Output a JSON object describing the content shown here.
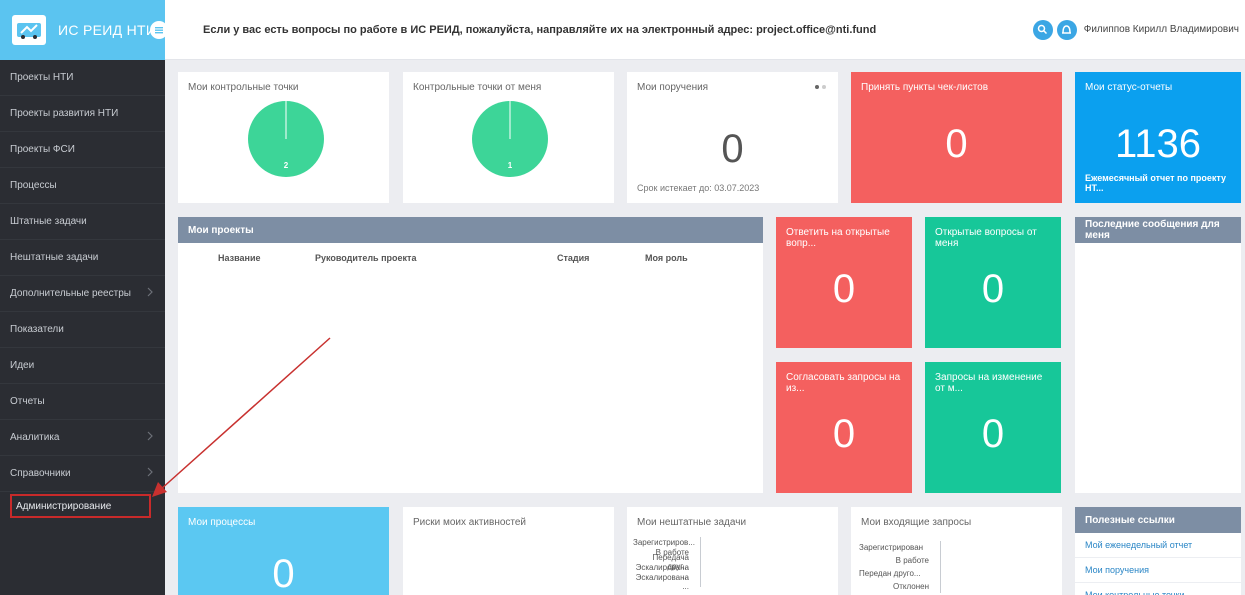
{
  "header": {
    "app_title": "ИС РЕИД НТИ",
    "notice": "Если у вас есть вопросы по работе в ИС РЕИД, пожалуйста, направляйте их на электронный адрес: project.office@nti.fund",
    "user_name": "Филиппов Кирилл Владимирович"
  },
  "sidebar": {
    "items": [
      {
        "label": "Проекты НТИ"
      },
      {
        "label": "Проекты развития НТИ"
      },
      {
        "label": "Проекты ФСИ"
      },
      {
        "label": "Процессы"
      },
      {
        "label": "Штатные задачи"
      },
      {
        "label": "Нештатные задачи"
      },
      {
        "label": "Дополнительные реестры"
      },
      {
        "label": "Показатели"
      },
      {
        "label": "Идеи"
      },
      {
        "label": "Отчеты"
      },
      {
        "label": "Аналитика"
      },
      {
        "label": "Справочники"
      },
      {
        "label": "Администрирование"
      }
    ]
  },
  "tiles": {
    "my_checkpoints": {
      "title": "Мои контрольные точки",
      "value": "2"
    },
    "checkpoints_from_me": {
      "title": "Контрольные точки от меня",
      "value": "1"
    },
    "my_orders": {
      "title": "Мои поручения",
      "value": "0",
      "footer": "Срок истекает до: 03.07.2023"
    },
    "accept_checklist": {
      "title": "Принять пункты чек-листов",
      "value": "0"
    },
    "my_status_reports": {
      "title": "Мои статус-отчеты",
      "value": "1136",
      "footer": "Ежемесячный отчет по проекту НТ..."
    },
    "answer_open_questions": {
      "title": "Ответить на открытые вопр...",
      "value": "0"
    },
    "open_questions_from_me": {
      "title": "Открытые вопросы от меня",
      "value": "0"
    },
    "approve_change_requests": {
      "title": "Согласовать запросы на из...",
      "value": "0"
    },
    "change_requests_from_me": {
      "title": "Запросы на изменение от м...",
      "value": "0"
    },
    "my_processes": {
      "title": "Мои процессы",
      "value": "0"
    },
    "activity_risks": {
      "title": "Риски моих активностей"
    },
    "my_unplanned_tasks": {
      "title": "Мои нештатные задачи",
      "rows": [
        "Зарегистриров...",
        "В работе",
        "Передача друг...",
        "Эскалирована ...",
        "Эскалирована ..."
      ]
    },
    "my_incoming_requests": {
      "title": "Мои входящие запросы",
      "rows": [
        "Зарегистрирован",
        "В работе",
        "Передан друго...",
        "Отклонен"
      ]
    }
  },
  "projects": {
    "title": "Мои проекты",
    "columns": [
      "Название",
      "Руководитель проекта",
      "Стадия",
      "Моя роль"
    ]
  },
  "messages": {
    "title": "Последние сообщения для меня"
  },
  "useful_links": {
    "title": "Полезные ссылки",
    "items": [
      "Мой еженедельный отчет",
      "Мои поручения",
      "Мои контрольные точки"
    ]
  }
}
